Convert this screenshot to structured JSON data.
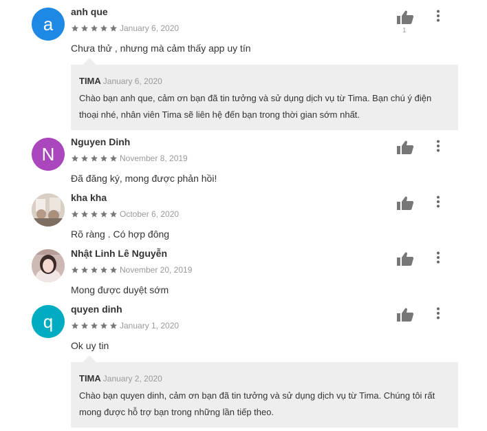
{
  "colors": {
    "star": "#777777",
    "thumb": "#777777",
    "reply_bg": "#eeeeee",
    "avatar_a": "#1e88e5",
    "avatar_n": "#ab47bc",
    "avatar_q": "#00acc1"
  },
  "icons": {
    "like": "thumbs-up-icon",
    "menu": "more-vert-icon",
    "star": "star-icon"
  },
  "reviews": [
    {
      "author": "anh que",
      "avatar_letter": "a",
      "rating": 5,
      "date": "January 6, 2020",
      "text": "Chưa thử , nhưng mà cảm thấy app uy tín",
      "likes": "1",
      "reply": {
        "author": "TIMA",
        "date": "January 6, 2020",
        "text": "Chào bạn anh que, cảm ơn bạn đã tin tưởng và sử dụng dịch vụ từ Tima. Bạn chú ý điện thoại nhé, nhân viên Tima sẽ liên hệ đến bạn trong thời gian sớm nhất."
      }
    },
    {
      "author": "Nguyen Dinh",
      "avatar_letter": "N",
      "rating": 5,
      "date": "November 8, 2019",
      "text": "Đã đăng ký, mong được phản hồi!"
    },
    {
      "author": "kha kha",
      "rating": 5,
      "date": "October 6, 2020",
      "text": "Rõ ràng . Có hợp đông"
    },
    {
      "author": "Nhật Linh Lê Nguyễn",
      "rating": 5,
      "date": "November 20, 2019",
      "text": "Mong được duyệt sớm"
    },
    {
      "author": "quyen dinh",
      "avatar_letter": "q",
      "rating": 5,
      "date": "January 1, 2020",
      "text": "Ok uy tin",
      "reply": {
        "author": "TIMA",
        "date": "January 2, 2020",
        "text": "Chào bạn quyen dinh, cảm ơn bạn đã tin tưởng và sử dụng dịch vụ từ Tima. Chúng tôi rất mong được hỗ trợ bạn trong những lần tiếp theo."
      }
    }
  ]
}
